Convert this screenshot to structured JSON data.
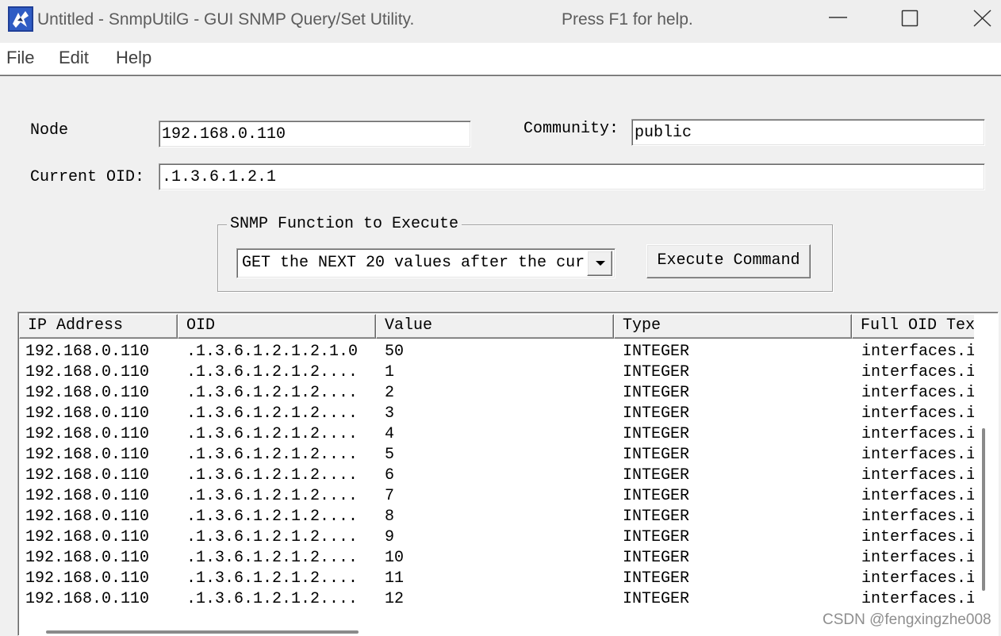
{
  "window": {
    "title": "Untitled - SnmpUtilG - GUI SNMP Query/Set Utility.",
    "help_hint": "Press F1 for help."
  },
  "menu": {
    "items": [
      {
        "label": "File"
      },
      {
        "label": "Edit"
      },
      {
        "label": "Help"
      }
    ]
  },
  "form": {
    "node": {
      "label": "Node",
      "value": "192.168.0.110"
    },
    "community": {
      "label": "Community:",
      "value": "public"
    },
    "current_oid": {
      "label": "Current OID:",
      "value": ".1.3.6.1.2.1"
    },
    "function": {
      "group_label": "SNMP Function to Execute",
      "selected": "GET the NEXT 20 values after the cur"
    },
    "execute_label": "Execute Command"
  },
  "results": {
    "columns": [
      "IP Address",
      "OID",
      "Value",
      "Type",
      "Full OID Tex"
    ],
    "rows": [
      [
        "192.168.0.110",
        ".1.3.6.1.2.1.2.1.0",
        "50",
        "INTEGER",
        "interfaces.i"
      ],
      [
        "192.168.0.110",
        ".1.3.6.1.2.1.2....",
        "1",
        "INTEGER",
        "interfaces.i"
      ],
      [
        "192.168.0.110",
        ".1.3.6.1.2.1.2....",
        "2",
        "INTEGER",
        "interfaces.i"
      ],
      [
        "192.168.0.110",
        ".1.3.6.1.2.1.2....",
        "3",
        "INTEGER",
        "interfaces.i"
      ],
      [
        "192.168.0.110",
        ".1.3.6.1.2.1.2....",
        "4",
        "INTEGER",
        "interfaces.i"
      ],
      [
        "192.168.0.110",
        ".1.3.6.1.2.1.2....",
        "5",
        "INTEGER",
        "interfaces.i"
      ],
      [
        "192.168.0.110",
        ".1.3.6.1.2.1.2....",
        "6",
        "INTEGER",
        "interfaces.i"
      ],
      [
        "192.168.0.110",
        ".1.3.6.1.2.1.2....",
        "7",
        "INTEGER",
        "interfaces.i"
      ],
      [
        "192.168.0.110",
        ".1.3.6.1.2.1.2....",
        "8",
        "INTEGER",
        "interfaces.i"
      ],
      [
        "192.168.0.110",
        ".1.3.6.1.2.1.2....",
        "9",
        "INTEGER",
        "interfaces.i"
      ],
      [
        "192.168.0.110",
        ".1.3.6.1.2.1.2....",
        "10",
        "INTEGER",
        "interfaces.i"
      ],
      [
        "192.168.0.110",
        ".1.3.6.1.2.1.2....",
        "11",
        "INTEGER",
        "interfaces.i"
      ],
      [
        "192.168.0.110",
        ".1.3.6.1.2.1.2....",
        "12",
        "INTEGER",
        "interfaces.i"
      ]
    ]
  },
  "watermark": "CSDN @fengxingzhe008",
  "icons": {
    "app": "app-icon",
    "minimize": "minimize-icon",
    "maximize": "maximize-icon",
    "close": "close-icon",
    "dropdown": "chevron-down-icon"
  },
  "colors": {
    "client_bg": "#f0f0f0",
    "list_bg": "#ffffff",
    "title_text": "#5c5c5c",
    "scroll_thumb": "#8a8a8a"
  }
}
